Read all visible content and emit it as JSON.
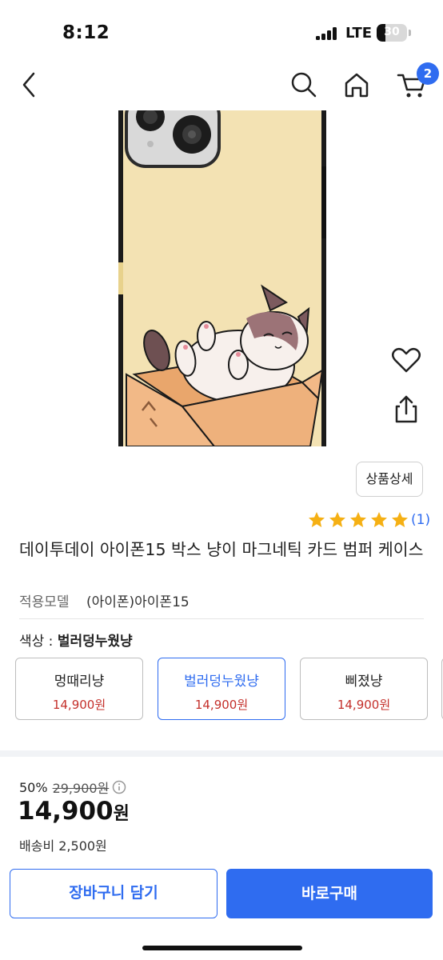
{
  "status_bar": {
    "time": "8:12",
    "network": "LTE",
    "battery": "30",
    "battery_level": 0.3
  },
  "nav": {
    "cart_badge": "2",
    "icons": [
      "back-icon",
      "search-icon",
      "home-icon",
      "cart-icon"
    ]
  },
  "actions": {
    "detail_label": "상품상세",
    "side_icons": [
      "heart-icon",
      "share-icon"
    ]
  },
  "rating": {
    "stars": 5,
    "review_count": "(1)"
  },
  "product": {
    "title": "데이투데이 아이폰15 박스 냥이 마그네틱 카드 범퍼 케이스",
    "model_label": "적용모델",
    "model_value": "(아이폰)아이폰15",
    "color_label": "색상 : ",
    "color_value": "벌러덩누웠냥"
  },
  "options": [
    {
      "name": "멍때리냥",
      "price": "14,900원",
      "selected": false
    },
    {
      "name": "벌러덩누웠냥",
      "price": "14,900원",
      "selected": true
    },
    {
      "name": "삐졌냥",
      "price": "14,900원",
      "selected": false
    }
  ],
  "pricing": {
    "discount_rate": "50%",
    "original_price": "29,900원",
    "final_price": "14,900",
    "final_unit": "원",
    "shipping": "배송비 2,500원"
  },
  "buttons": {
    "cart": "장바구니 담기",
    "buy": "바로구매"
  },
  "colors": {
    "accent": "#2f6cf0",
    "price_red": "#c4302b",
    "star": "#f5b014",
    "case_bg": "#f3e2b3"
  }
}
